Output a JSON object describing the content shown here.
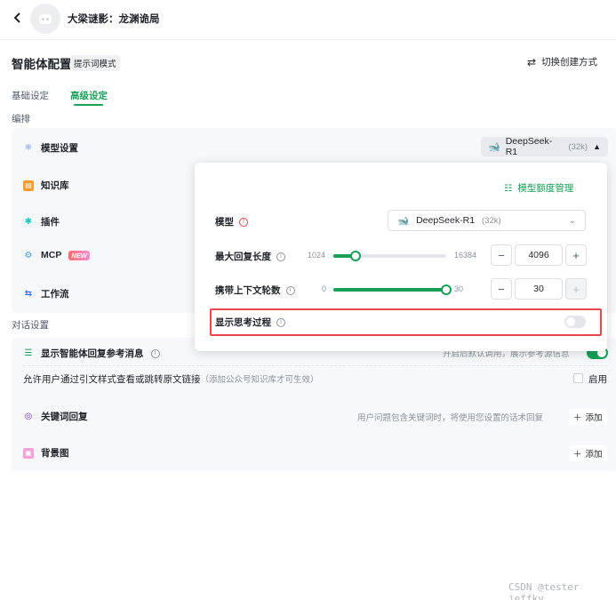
{
  "header": {
    "back_icon": "chevron-left-icon",
    "bot_name": "大梁谜影：龙渊诡局"
  },
  "config": {
    "title": "智能体配置",
    "mode_badge": "提示词模式",
    "switch_label": "切换创建方式",
    "switch_icon": "swap-icon"
  },
  "tabs": [
    {
      "label": "基础设定",
      "active": false
    },
    {
      "label": "高级设定",
      "active": true
    }
  ],
  "sections": {
    "orchestration": "编排",
    "dialog": "对话设置"
  },
  "orchestration_items": [
    {
      "label": "模型设置",
      "icon": "model-icon"
    },
    {
      "label": "知识库",
      "icon": "knowledge-icon"
    },
    {
      "label": "插件",
      "icon": "plugin-icon"
    },
    {
      "label": "MCP",
      "icon": "mcp-icon",
      "badge": "NEW"
    },
    {
      "label": "工作流",
      "icon": "workflow-icon"
    }
  ],
  "model_chip": {
    "name": "DeepSeek-R1",
    "context": "(32k)"
  },
  "popover": {
    "quota_label": "模型额度管理",
    "model_label": "模型",
    "model_value": "DeepSeek-R1",
    "model_context": "(32k)",
    "max_reply": {
      "label": "最大回复长度",
      "min": "1024",
      "max": "16384",
      "value": "4096",
      "fraction": 0.2
    },
    "context_rounds": {
      "label": "携带上下文轮数",
      "min": "0",
      "max": "30",
      "value": "30",
      "fraction": 1.0
    },
    "show_thinking": {
      "label": "显示思考过程",
      "enabled": false
    }
  },
  "dialog_items": {
    "show_reference": {
      "label": "显示智能体回复参考消息",
      "hint": "开启后默认调用，展示参考源信息",
      "enabled": true
    },
    "allow_link": {
      "label": "允许用户通过引文样式查看或跳转原文链接",
      "note": "（添加公众号知识库才可生效）",
      "checkbox_label": "启用"
    },
    "keyword_reply": {
      "label": "关键词回复",
      "hint": "用户问题包含关键词时，将使用您设置的话术回复",
      "add_label": "添加"
    },
    "background": {
      "label": "背景图",
      "add_label": "添加"
    }
  },
  "watermark": "CSDN @tester jeffky",
  "colors": {
    "accent": "#18a058",
    "highlight": "#e5484d"
  }
}
